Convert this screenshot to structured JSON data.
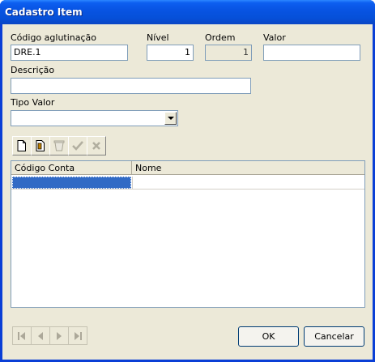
{
  "window": {
    "title": "Cadastro Item"
  },
  "form": {
    "codigo_label": "Código aglutinação",
    "codigo_value": "DRE.1",
    "nivel_label": "Nível",
    "nivel_value": "1",
    "ordem_label": "Ordem",
    "ordem_value": "1",
    "valor_label": "Valor",
    "valor_value": "",
    "descricao_label": "Descrição",
    "descricao_value": "",
    "tipo_label": "Tipo Valor",
    "tipo_value": ""
  },
  "toolbar": {
    "icons": [
      "new-document-icon",
      "edit-document-icon",
      "delete-icon",
      "confirm-check-icon",
      "cancel-x-icon"
    ]
  },
  "grid": {
    "columns": [
      "Código Conta",
      "Nome"
    ],
    "rows": [
      [
        "",
        ""
      ]
    ]
  },
  "navigator": {
    "icons": [
      "first-record-icon",
      "prior-record-icon",
      "next-record-icon",
      "last-record-icon"
    ]
  },
  "buttons": {
    "ok": "OK",
    "cancel": "Cancelar"
  },
  "colors": {
    "title_bar": "#0854e3",
    "face": "#ece9d8",
    "selection": "#316ac5",
    "field_border": "#7f9db9"
  }
}
